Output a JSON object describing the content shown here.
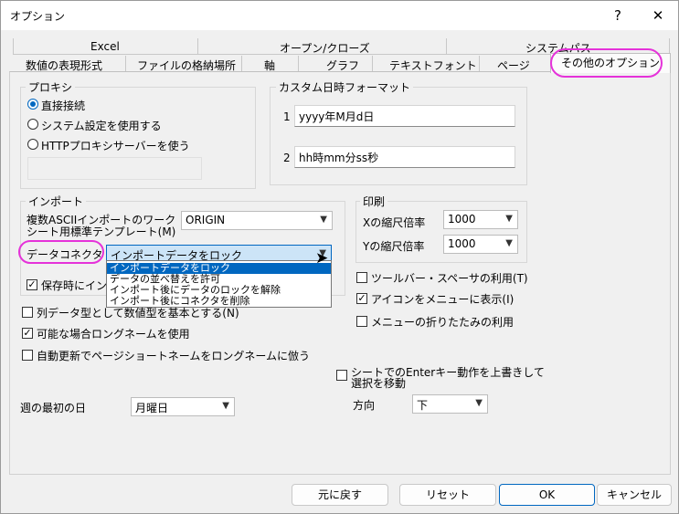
{
  "window": {
    "title": "オプション",
    "help_label": "?",
    "close_label": "✕"
  },
  "tabs": {
    "back_row": [
      "Excel",
      "オープン/クローズ",
      "システムパス"
    ],
    "front_row": [
      "数値の表現形式",
      "ファイルの格納場所",
      "軸",
      "グラフ",
      "テキストフォント",
      "ページ"
    ],
    "active": "その他のオプション"
  },
  "proxy": {
    "title": "プロキシ",
    "options": [
      "直接接続",
      "システム設定を使用する",
      "HTTPプロキシサーバーを使う"
    ],
    "selected": "直接接続"
  },
  "custom_datetime": {
    "title": "カスタム日時フォーマット",
    "rows": [
      {
        "num": "1",
        "value": "yyyy年M月d日"
      },
      {
        "num": "2",
        "value": "hh時mm分ss秒"
      }
    ]
  },
  "import": {
    "title": "インポート",
    "template_label_1": "複数ASCIIインポートのワーク",
    "template_label_2": "シート用標準テンプレート(M)",
    "template_value": "ORIGIN",
    "connector_label": "データコネクタ",
    "connector_value": "インポートデータをロック",
    "connector_options": [
      "インポートデータをロック",
      "データの並べ替えを許可",
      "インポート後にデータのロックを解除",
      "インポート後にコネクタを削除"
    ],
    "save_label_partial": "保存時にインポ"
  },
  "print": {
    "title": "印刷",
    "x_label": "Xの縮尺倍率",
    "x_value": "1000",
    "y_label": "Yの縮尺倍率",
    "y_value": "1000"
  },
  "checks": {
    "col_data_type": {
      "label": "列データ型として数値型を基本とする(N)",
      "checked": false
    },
    "long_name": {
      "label": "可能な場合ロングネームを使用",
      "checked": true
    },
    "auto_update": {
      "label": "自動更新でページショートネームをロングネームに倣う",
      "checked": false
    },
    "toolbar_spacer": {
      "label": "ツールバー・スペーサの利用(T)",
      "checked": false
    },
    "icon_in_menu": {
      "label": "アイコンをメニューに表示(I)",
      "checked": true
    },
    "menu_folding": {
      "label": "メニューの折りたたみの利用",
      "checked": false
    },
    "enter_override_1": {
      "label": "シートでのEnterキー動作を上書きして",
      "checked": false
    },
    "enter_override_2": "選択を移動"
  },
  "week": {
    "label": "週の最初の日",
    "value": "月曜日"
  },
  "direction": {
    "label": "方向",
    "value": "下"
  },
  "buttons": {
    "restore": "元に戻す",
    "reset": "リセット",
    "ok": "OK",
    "cancel": "キャンセル"
  },
  "colors": {
    "accent": "#0067c0",
    "highlight_oval": "#e532d9"
  }
}
